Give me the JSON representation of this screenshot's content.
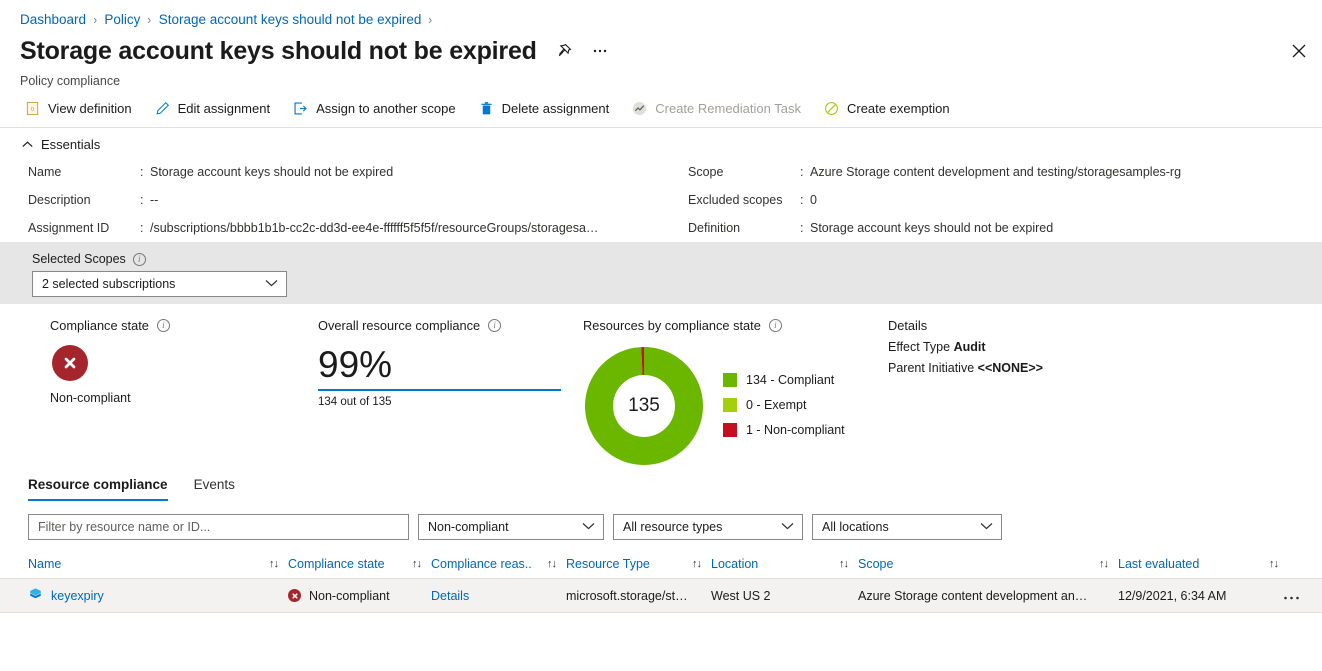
{
  "breadcrumb": {
    "items": [
      {
        "label": "Dashboard"
      },
      {
        "label": "Policy"
      },
      {
        "label": "Storage account keys should not be expired"
      }
    ],
    "separator": "›"
  },
  "header": {
    "title": "Storage account keys should not be expired",
    "subtitle": "Policy compliance",
    "pin_icon": "pin-icon",
    "more_icon": "ellipsis-icon",
    "close_icon": "close-icon"
  },
  "commandbar": {
    "items": [
      {
        "label": "View definition",
        "icon": "document-icon",
        "disabled": false
      },
      {
        "label": "Edit assignment",
        "icon": "pencil-icon",
        "disabled": false
      },
      {
        "label": "Assign to another scope",
        "icon": "export-arrow-icon",
        "disabled": false
      },
      {
        "label": "Delete assignment",
        "icon": "trash-icon",
        "disabled": false
      },
      {
        "label": "Create Remediation Task",
        "icon": "chart-line-icon",
        "disabled": true
      },
      {
        "label": "Create exemption",
        "icon": "forbidden-circle-icon",
        "disabled": false
      }
    ]
  },
  "essentials": {
    "section_label": "Essentials",
    "collapse_icon": "chevron-up-icon",
    "left": [
      {
        "label": "Name",
        "value": "Storage account keys should not be expired"
      },
      {
        "label": "Description",
        "value": "--"
      },
      {
        "label": "Assignment ID",
        "value": "/subscriptions/bbbb1b1b-cc2c-dd3d-ee4e-ffffff5f5f5f/resourceGroups/storagesa…"
      }
    ],
    "right": [
      {
        "label": "Scope",
        "value": "Azure Storage content development and testing/storagesamples-rg"
      },
      {
        "label": "Excluded scopes",
        "value": "0"
      },
      {
        "label": "Definition",
        "value": "Storage account keys should not be expired"
      }
    ]
  },
  "selected_scopes": {
    "label": "Selected Scopes",
    "info_icon": "info-icon",
    "value": "2 selected subscriptions",
    "chevron_icon": "chevron-down-icon"
  },
  "metrics": {
    "compliance_state": {
      "title": "Compliance state",
      "info_icon": "info-icon",
      "status_icon": "error-circle-icon",
      "status": "Non-compliant",
      "color": "#a4262c"
    },
    "overall": {
      "title": "Overall resource compliance",
      "info_icon": "info-icon",
      "percent": "99%",
      "percent_value": 99,
      "subtext": "134 out of 135",
      "bar_color": "#0078d4"
    },
    "details": {
      "title": "Details",
      "rows": [
        {
          "label": "Effect Type",
          "value": "Audit"
        },
        {
          "label": "Parent Initiative",
          "value": "<<NONE>>"
        }
      ]
    }
  },
  "chart_data": {
    "type": "pie",
    "title": "Resources by compliance state",
    "info_icon": "info-icon",
    "center_label": "135",
    "total": 135,
    "categories": [
      "Compliant",
      "Exempt",
      "Non-compliant"
    ],
    "values": [
      134,
      0,
      1
    ],
    "colors": [
      "#6bb700",
      "#a4cf0c",
      "#c50f1f"
    ],
    "legend": [
      {
        "text": "134 - Compliant",
        "color": "#6bb700"
      },
      {
        "text": "0 - Exempt",
        "color": "#a4cf0c"
      },
      {
        "text": "1 - Non-compliant",
        "color": "#c50f1f"
      }
    ],
    "legend_position": "right",
    "grid": false
  },
  "tabs": [
    {
      "label": "Resource compliance",
      "active": true
    },
    {
      "label": "Events",
      "active": false
    }
  ],
  "filters": {
    "search_placeholder": "Filter by resource name or ID...",
    "search_value": "",
    "compliance_select": "Non-compliant",
    "resource_type_select": "All resource types",
    "location_select": "All locations",
    "chevron_icon": "chevron-down-icon"
  },
  "table": {
    "sort_icon": "↑↓",
    "columns": [
      {
        "label": "Name",
        "sortable": true
      },
      {
        "label": "Compliance state",
        "sortable": true
      },
      {
        "label": "Compliance reas..",
        "sortable": true
      },
      {
        "label": "Resource Type",
        "sortable": true
      },
      {
        "label": "Location",
        "sortable": true
      },
      {
        "label": "Scope",
        "sortable": true
      },
      {
        "label": "Last evaluated",
        "sortable": true
      }
    ],
    "rows": [
      {
        "name": "keyexpiry",
        "name_icon": "storage-account-icon",
        "state": "Non-compliant",
        "state_icon": "error-circle-icon",
        "reason": "Details",
        "resource_type": "microsoft.storage/st…",
        "location": "West US 2",
        "scope": "Azure Storage content development an…",
        "last_evaluated": "12/9/2021, 6:34 AM",
        "menu_icon": "ellipsis-icon"
      }
    ]
  }
}
